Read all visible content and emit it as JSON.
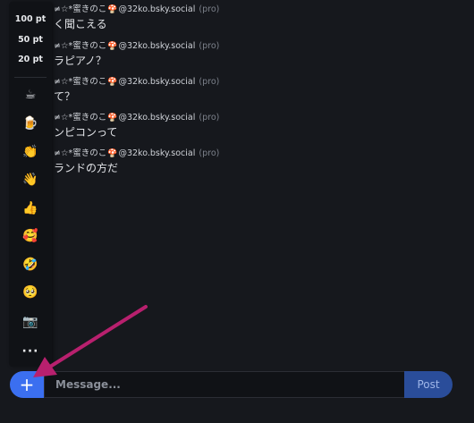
{
  "messages": [
    {
      "user": "≠☆*蜜きのこ",
      "handle": "@32ko.bsky.social",
      "badge": "(pro)",
      "text": "く聞こえる"
    },
    {
      "user": "≠☆*蜜きのこ",
      "handle": "@32ko.bsky.social",
      "badge": "(pro)",
      "text": "ラピアノ？"
    },
    {
      "user": "≠☆*蜜きのこ",
      "handle": "@32ko.bsky.social",
      "badge": "(pro)",
      "text": "て？"
    },
    {
      "user": "≠☆*蜜きのこ",
      "handle": "@32ko.bsky.social",
      "badge": "(pro)",
      "text": "ンピコンって"
    },
    {
      "user": "≠☆*蜜きのこ",
      "handle": "@32ko.bsky.social",
      "badge": "(pro)",
      "text": "ランドの方だ"
    }
  ],
  "mushroom_icon": "🍄",
  "picker": {
    "points": [
      "100 pt",
      "50 pt",
      "20 pt"
    ],
    "emojis": [
      "☕",
      "🍺",
      "👏",
      "👋",
      "👍",
      "🥰",
      "🤣",
      "🥺",
      "📷"
    ],
    "more": "···"
  },
  "composer": {
    "plus_label": "+",
    "placeholder": "Message...",
    "post_label": "Post"
  },
  "colors": {
    "background": "#16181d",
    "accent": "#3b6ff0",
    "post_button": "#2a4d9a",
    "arrow": "#b8206e"
  }
}
